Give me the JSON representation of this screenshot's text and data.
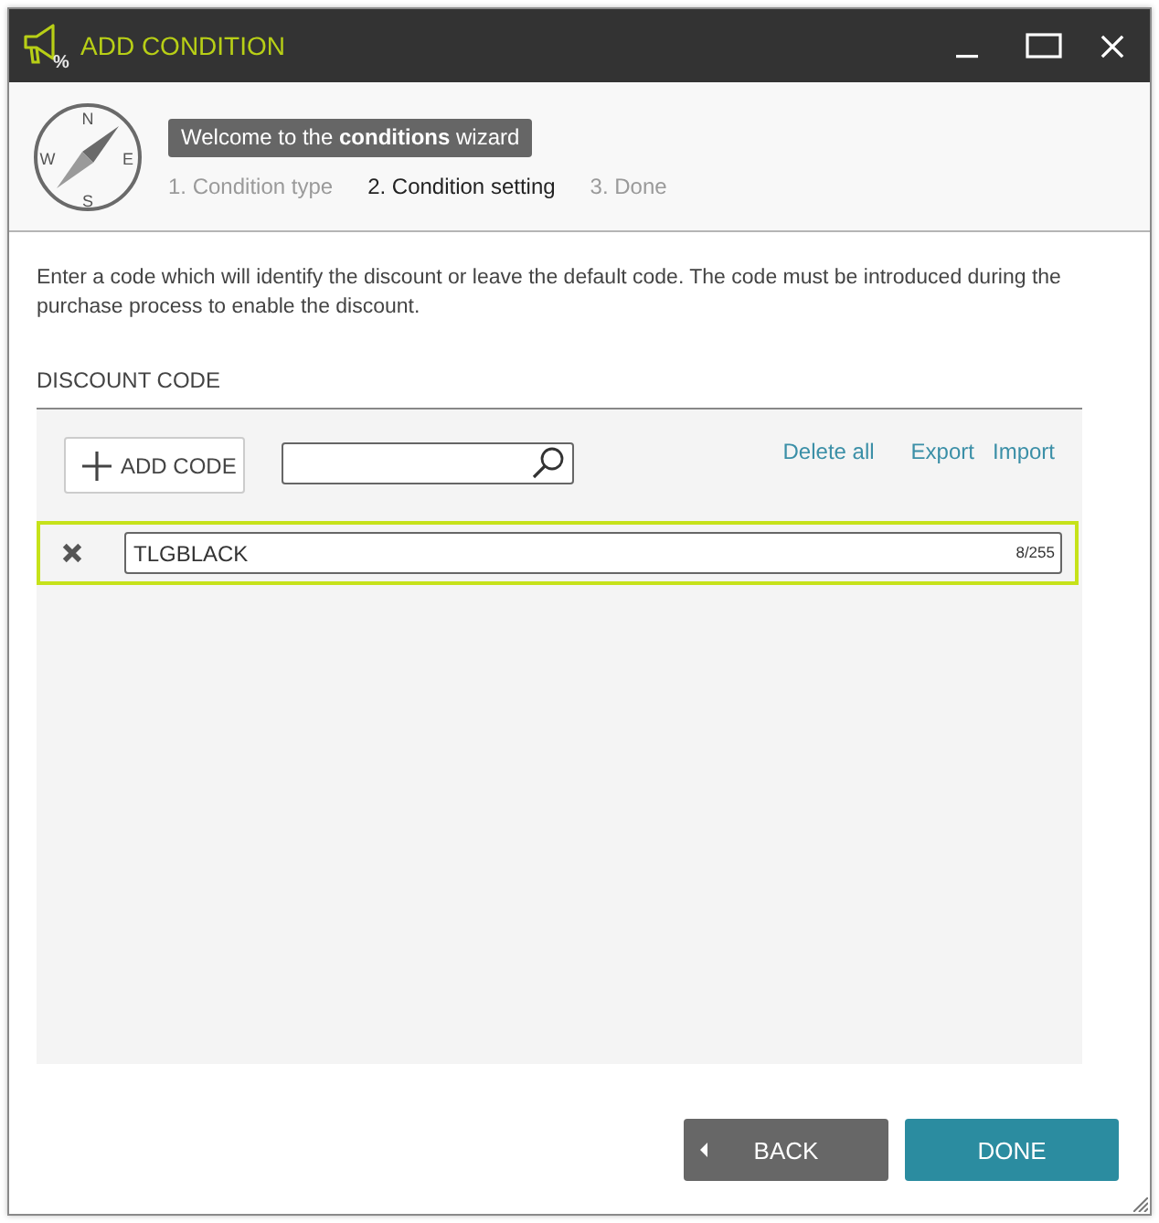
{
  "window": {
    "title": "ADD CONDITION",
    "icon_mark": "%"
  },
  "wizard": {
    "compass_letters": [
      "N",
      "E",
      "S",
      "W"
    ],
    "welcome": "Welcome to the **conditions** wizard",
    "steps": [
      {
        "label": "1. Condition type",
        "selected": false
      },
      {
        "label": "2. Condition setting",
        "selected": true
      },
      {
        "label": "3. Done",
        "selected": false
      }
    ]
  },
  "description": "Enter a code which will identify the discount or leave the default code. The code must be introduced during the purchase process to enable the discount.",
  "discount_code": {
    "heading": "DISCOUNT CODE",
    "add_button": "ADD CODE",
    "links": [
      "Delete all",
      "Export",
      "Import"
    ],
    "codes": [
      {
        "value": "TLGBLACK",
        "counter": "8/255",
        "selected": true
      }
    ]
  },
  "buttons": [
    {
      "label": "BACK",
      "kind": "back"
    },
    {
      "label": "DONE",
      "kind": "primary"
    }
  ]
}
